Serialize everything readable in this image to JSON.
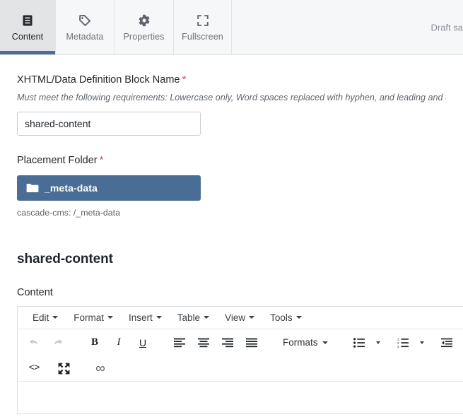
{
  "tabs": [
    {
      "label": "Content",
      "icon": "document-lines-icon",
      "active": true
    },
    {
      "label": "Metadata",
      "icon": "tag-icon",
      "active": false
    },
    {
      "label": "Properties",
      "icon": "gear-icon",
      "active": false
    },
    {
      "label": "Fullscreen",
      "icon": "expand-corners-icon",
      "active": false
    }
  ],
  "status": {
    "draft_text": "Draft sa"
  },
  "form": {
    "name_field": {
      "label": "XHTML/Data Definition Block Name",
      "required_marker": "*",
      "help": "Must meet the following requirements: Lowercase only, Word spaces replaced with hyphen, and leading and trailing spa",
      "value": "shared-content",
      "placeholder": ""
    },
    "placement_folder": {
      "label": "Placement Folder",
      "required_marker": "*",
      "chip_label": "_meta-data",
      "chip_icon": "folder-icon",
      "path": "cascade-cms: /_meta-data"
    }
  },
  "section": {
    "title": "shared-content",
    "content_label": "Content"
  },
  "editor": {
    "menubar": [
      {
        "label": "Edit"
      },
      {
        "label": "Format"
      },
      {
        "label": "Insert"
      },
      {
        "label": "Table"
      },
      {
        "label": "View"
      },
      {
        "label": "Tools"
      }
    ],
    "toolbar_row1": [
      {
        "name": "undo",
        "glyph": "↶",
        "disabled": true
      },
      {
        "name": "redo",
        "glyph": "↷",
        "disabled": true
      },
      {
        "name": "bold",
        "glyph": "B",
        "disabled": false
      },
      {
        "name": "italic",
        "glyph": "I",
        "disabled": false
      },
      {
        "name": "underline",
        "glyph": "U",
        "disabled": false
      },
      {
        "name": "align-left",
        "glyph": "",
        "disabled": false
      },
      {
        "name": "align-center",
        "glyph": "",
        "disabled": false
      },
      {
        "name": "align-right",
        "glyph": "",
        "disabled": false
      },
      {
        "name": "align-justify",
        "glyph": "",
        "disabled": false
      }
    ],
    "formats_label": "Formats",
    "toolbar_row2": [
      {
        "name": "source-code",
        "glyph": "<>"
      },
      {
        "name": "fullscreen",
        "glyph": ""
      },
      {
        "name": "link",
        "glyph": "∞"
      }
    ],
    "content": ""
  },
  "colors": {
    "accent_blue": "#4a6d9b",
    "chip_blue": "#4a6d96",
    "required_red": "#e8455f",
    "tab_active_bg": "#e3e4e6",
    "tabbar_bg": "#f6f7f8"
  }
}
